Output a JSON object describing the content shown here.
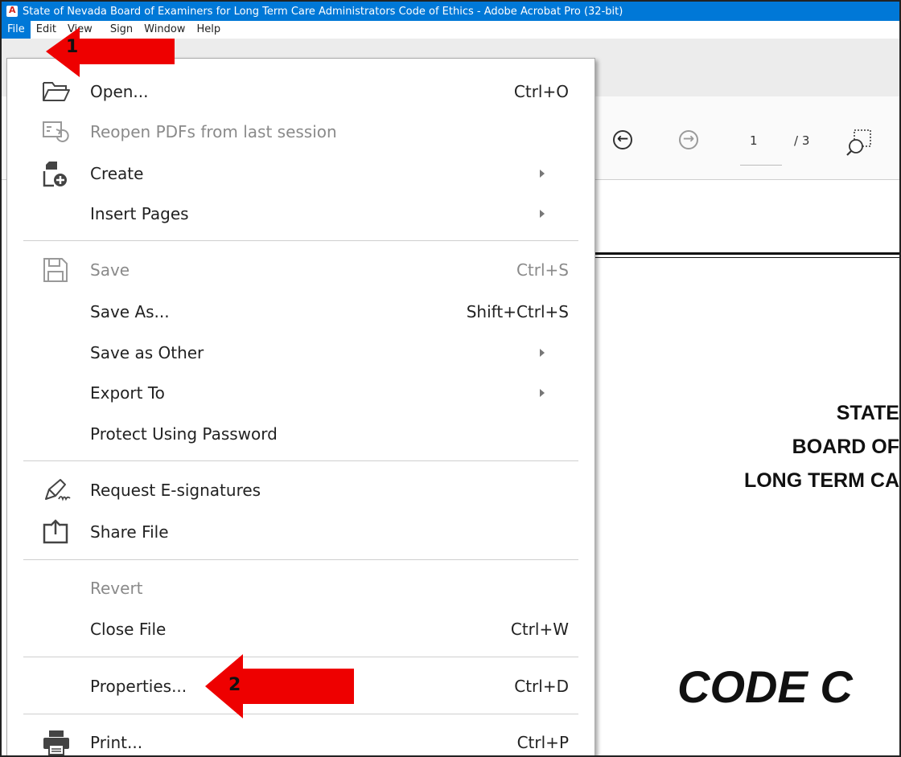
{
  "window": {
    "title": "State of Nevada Board of Examiners for Long Term Care Administrators Code of Ethics - Adobe Acrobat Pro (32-bit)"
  },
  "menubar": {
    "items": [
      "File",
      "Edit",
      "View",
      "Sign",
      "Window",
      "Help"
    ],
    "active": "File"
  },
  "toolbar": {
    "page_current": "1",
    "page_total": "/ 3"
  },
  "file_menu": {
    "open": {
      "label": "Open...",
      "shortcut": "Ctrl+O"
    },
    "reopen": {
      "label": "Reopen PDFs from last session"
    },
    "create": {
      "label": "Create"
    },
    "insert_pages": {
      "label": "Insert Pages"
    },
    "save": {
      "label": "Save",
      "shortcut": "Ctrl+S"
    },
    "save_as": {
      "label": "Save As...",
      "shortcut": "Shift+Ctrl+S"
    },
    "save_as_other": {
      "label": "Save as Other"
    },
    "export_to": {
      "label": "Export To"
    },
    "protect": {
      "label": "Protect Using Password"
    },
    "request_esign": {
      "label": "Request E-signatures"
    },
    "share_file": {
      "label": "Share File"
    },
    "revert": {
      "label": "Revert"
    },
    "close_file": {
      "label": "Close File",
      "shortcut": "Ctrl+W"
    },
    "properties": {
      "label": "Properties...",
      "shortcut": "Ctrl+D"
    },
    "print": {
      "label": "Print...",
      "shortcut": "Ctrl+P"
    }
  },
  "document": {
    "line1": "STATE",
    "line2": "BOARD OF",
    "line3": "LONG TERM CA",
    "line4": "CODE C"
  },
  "annotations": {
    "arrow1_label": "1",
    "arrow2_label": "2",
    "arrow_color": "#ee0000"
  },
  "colors": {
    "titlebar": "#0078d7",
    "menu_highlight": "#0078d7"
  }
}
